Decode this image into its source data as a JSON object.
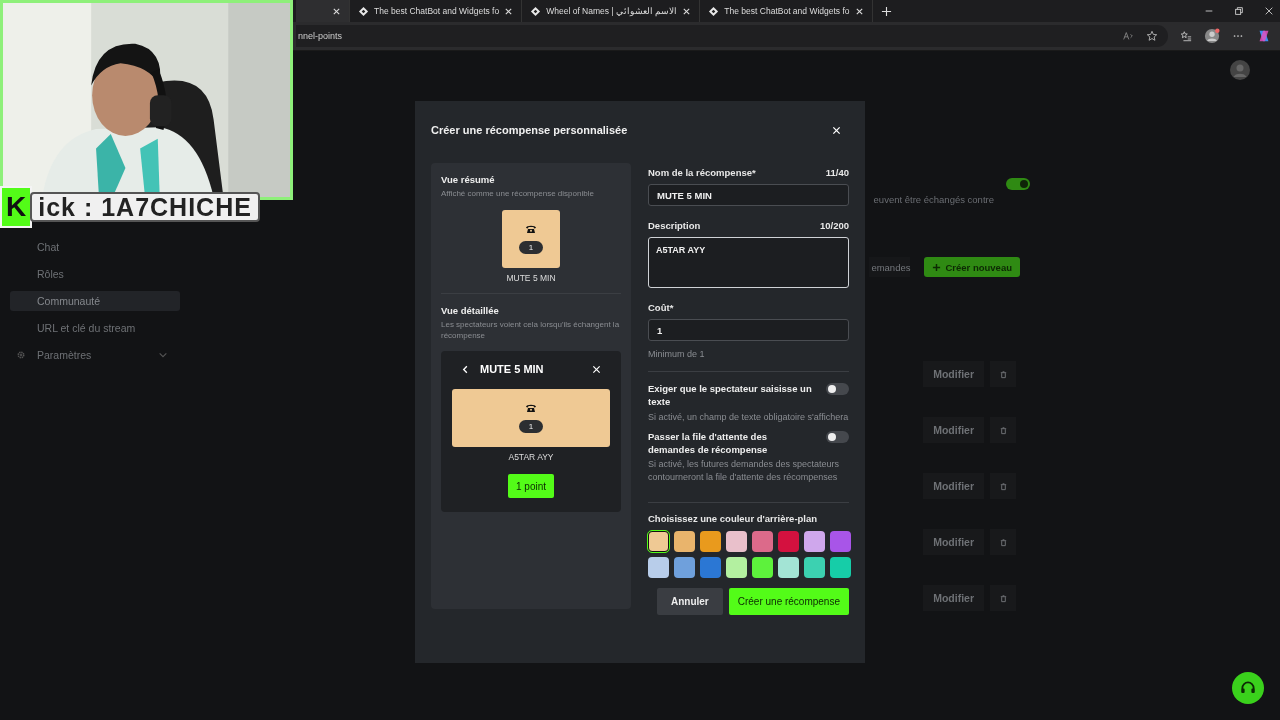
{
  "browser": {
    "tabs": [
      {
        "selected": true
      },
      {
        "title": "The best ChatBot and Widgets fo",
        "selected": false
      },
      {
        "title": "Wheel of Names | الاسم العشوائي",
        "selected": false
      },
      {
        "title": "The best ChatBot and Widgets fo",
        "selected": false
      }
    ],
    "url": "nnel-points"
  },
  "webcam": {
    "kind": "picture",
    "logo_letter": "K",
    "label": "ick : 1A7CHICHE"
  },
  "sidebar": {
    "items": [
      {
        "label": "Chat",
        "selected": false
      },
      {
        "label": "Rôles",
        "selected": false
      },
      {
        "label": "Communauté",
        "selected": true
      },
      {
        "label": "URL et clé du stream",
        "selected": false
      },
      {
        "label": "Paramètres",
        "selected": false,
        "kind": "group",
        "expanded": false
      }
    ]
  },
  "background": {
    "enabled": true,
    "hint": "euvent être échangés contre",
    "requests_button": "emandes",
    "create_button": "Créer nouveau",
    "rows": [
      {
        "edit": "Modifier"
      },
      {
        "edit": "Modifier"
      },
      {
        "edit": "Modifier"
      },
      {
        "edit": "Modifier"
      },
      {
        "edit": "Modifier"
      }
    ]
  },
  "dialog": {
    "title": "Créer une récompense personnalisée",
    "summary": {
      "title": "Vue résumé",
      "subtitle": "Affiché comme une récompense disponible",
      "cost": "1",
      "name": "MUTE 5 MIN"
    },
    "detail": {
      "title": "Vue détaillée",
      "subtitle": "Les spectateurs voient cela lorsqu'ils échangent la récompense",
      "header": "MUTE 5 MIN",
      "cost": "1",
      "description": "A5TAR AYY",
      "points_button": "1 point"
    },
    "name_field": {
      "label": "Nom de la récompense*",
      "count": "11/40",
      "value": "MUTE 5 MIN"
    },
    "description_field": {
      "label": "Description",
      "count": "10/200",
      "value": "A5TAR AYY"
    },
    "cost_field": {
      "label": "Coût*",
      "value": "1",
      "hint": "Minimum de 1"
    },
    "toggles": [
      {
        "label": "Exiger que le spectateur saisisse un texte",
        "hint": "Si activé, un champ de texte obligatoire s'affichera",
        "on": false
      },
      {
        "label": "Passer la file d'attente des demandes de récompense",
        "hint": "Si activé, les futures demandes des spectateurs contourneront la file d'attente des récompenses",
        "on": false
      }
    ],
    "color_label": "Choisissez une couleur d'arrière-plan",
    "colors": [
      {
        "color": "#efc994",
        "selected": true
      },
      {
        "color": "#e9b46c",
        "selected": false
      },
      {
        "color": "#e99a1d",
        "selected": false
      },
      {
        "color": "#e9c0cb",
        "selected": false
      },
      {
        "color": "#dc6a8a",
        "selected": false
      },
      {
        "color": "#d4113f",
        "selected": false
      },
      {
        "color": "#cfa7ec",
        "selected": false
      },
      {
        "color": "#a855e8",
        "selected": false
      },
      {
        "color": "#b8cdea",
        "selected": false
      },
      {
        "color": "#6fa0dc",
        "selected": false
      },
      {
        "color": "#2b77d4",
        "selected": false
      },
      {
        "color": "#b3f0a0",
        "selected": false
      },
      {
        "color": "#5df23c",
        "selected": false
      },
      {
        "color": "#a3e4d5",
        "selected": false
      },
      {
        "color": "#3cd1b1",
        "selected": false
      },
      {
        "color": "#16cda8",
        "selected": false
      }
    ],
    "cancel": "Annuler",
    "submit": "Créer une récompense"
  }
}
